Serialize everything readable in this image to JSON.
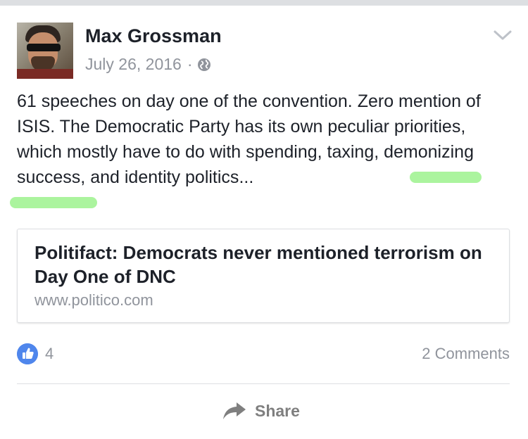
{
  "post": {
    "author": "Max Grossman",
    "date": "July 26, 2016",
    "separator": "·",
    "audience_icon": "globe-icon",
    "menu_icon": "chevron-down-icon",
    "text_before_highlight": "61 speeches on day one of the convention. Zero mention of ISIS. The Democratic Party has its own peculiar priorities, which mostly have to do with spending, taxing, demonizing success, and ",
    "text_highlighted": "identity politics",
    "text_after_highlight": "...",
    "highlight_color": "#8ff07e"
  },
  "link_preview": {
    "title": "Politifact: Democrats never mentioned terrorism on Day One of DNC",
    "domain": "www.politico.com"
  },
  "footer": {
    "like_icon": "thumbs-up-icon",
    "like_count": "4",
    "comments": "2 Comments",
    "share_icon": "share-arrow-icon",
    "share_label": "Share"
  },
  "colors": {
    "text": "#1d2129",
    "muted": "#90949c",
    "like_blue": "#4f86ec",
    "border": "#dddfe2"
  }
}
